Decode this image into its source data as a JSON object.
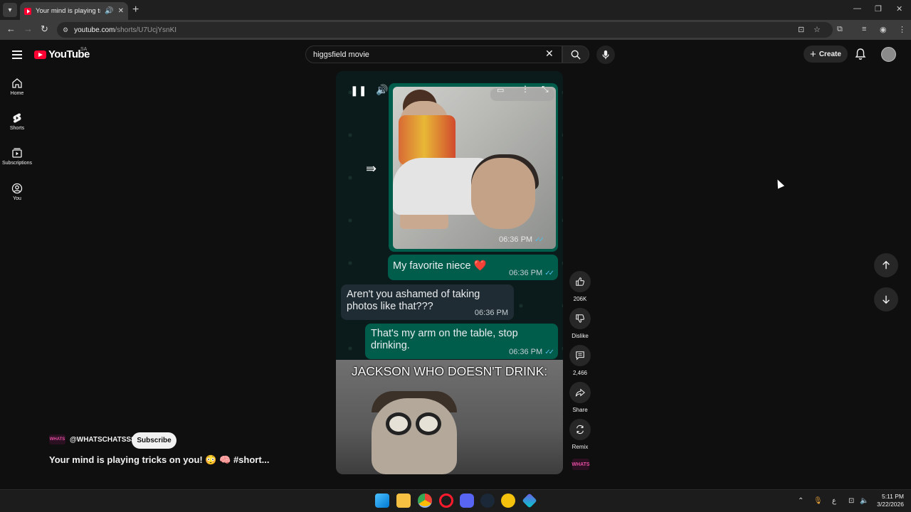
{
  "browser": {
    "tab_title": "Your mind is playing tricks o",
    "new_tab": "+",
    "address_host": "youtube.com",
    "address_path": "/shorts/U7UcjYsnKI"
  },
  "youtube": {
    "logo_text": "YouTube",
    "country_code": "SA",
    "search_value": "higgsfield movie",
    "create_label": "Create",
    "sidebar": {
      "items": [
        {
          "label": "Home"
        },
        {
          "label": "Shorts"
        },
        {
          "label": "Subscriptions"
        },
        {
          "label": "You"
        }
      ]
    }
  },
  "short": {
    "photo_timestamp": "06:36 PM",
    "messages": [
      {
        "text": "My favorite niece ❤️",
        "time": "06:36 PM",
        "dir": "out"
      },
      {
        "text": "Aren't you ashamed of taking photos like that???",
        "time": "06:36 PM",
        "dir": "in"
      },
      {
        "text": "That's my arm on the table, stop drinking.",
        "time": "06:36 PM",
        "dir": "out"
      }
    ],
    "meme_caption": "JACKSON WHO DOESN'T DRINK:",
    "actions": {
      "likes": "206K",
      "dislike": "Dislike",
      "comments": "2,466",
      "share": "Share",
      "remix": "Remix"
    },
    "channel_handle": "@WHATSCHATSSS",
    "channel_badge": "WHATS",
    "subscribe_label": "Subscribe",
    "video_title": "Your mind is playing tricks on you! 😳 🧠 #short..."
  },
  "taskbar": {
    "tray_lang": "ع",
    "time": "5:11 PM",
    "date": "3/22/2026"
  },
  "colors": {
    "yt_red": "#ff0033",
    "wa_out": "#005c4b",
    "wa_in": "#202c33",
    "wa_read_tick": "#53bdeb"
  }
}
